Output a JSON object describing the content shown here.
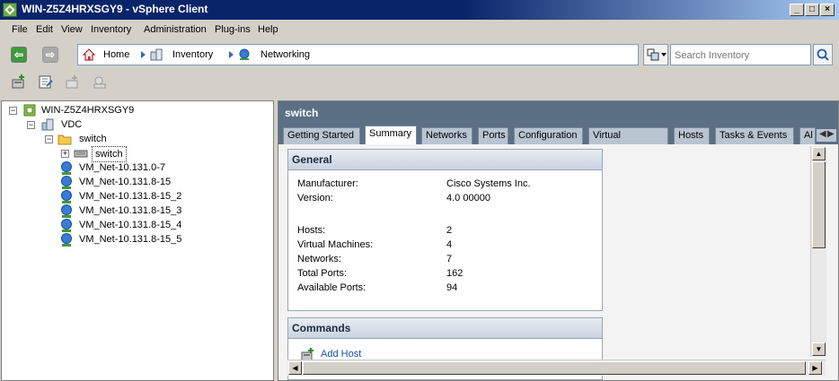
{
  "window": {
    "title": "WIN-Z5Z4HRXSGY9 - vSphere Client"
  },
  "menubar": [
    "File",
    "Edit",
    "View",
    "Inventory",
    "Administration",
    "Plug-ins",
    "Help"
  ],
  "breadcrumb": [
    "Home",
    "Inventory",
    "Networking"
  ],
  "search": {
    "placeholder": "Search Inventory"
  },
  "tree": {
    "root": "WIN-Z5Z4HRXSGY9",
    "datacenter": "VDC",
    "folder": "switch",
    "dvswitch": "switch",
    "networks": [
      "VM_Net-10.131.0-7",
      "VM_Net-10.131.8-15",
      "VM_Net-10.131.8-15_2",
      "VM_Net-10.131.8-15_3",
      "VM_Net-10.131.8-15_4",
      "VM_Net-10.131.8-15_5"
    ]
  },
  "detail": {
    "title": "switch",
    "tabs": [
      "Getting Started",
      "Summary",
      "Networks",
      "Ports",
      "Configuration",
      "Virtual Machines",
      "Hosts",
      "Tasks & Events",
      "Al"
    ],
    "active_tab": "Summary",
    "general": {
      "heading": "General",
      "rows": [
        {
          "label": "Manufacturer:",
          "value": "Cisco Systems Inc."
        },
        {
          "label": "Version:",
          "value": "4.0 00000"
        },
        {
          "label": "Hosts:",
          "value": "2"
        },
        {
          "label": "Virtual Machines:",
          "value": "4"
        },
        {
          "label": "Networks:",
          "value": "7"
        },
        {
          "label": "Total Ports:",
          "value": "162"
        },
        {
          "label": "Available Ports:",
          "value": "94"
        }
      ]
    },
    "commands": {
      "heading": "Commands",
      "items": [
        "Add Host"
      ]
    }
  },
  "colors": {
    "titlebar": "#0a246a",
    "panel_header": "#5b6f85",
    "link": "#1a4fa0"
  }
}
